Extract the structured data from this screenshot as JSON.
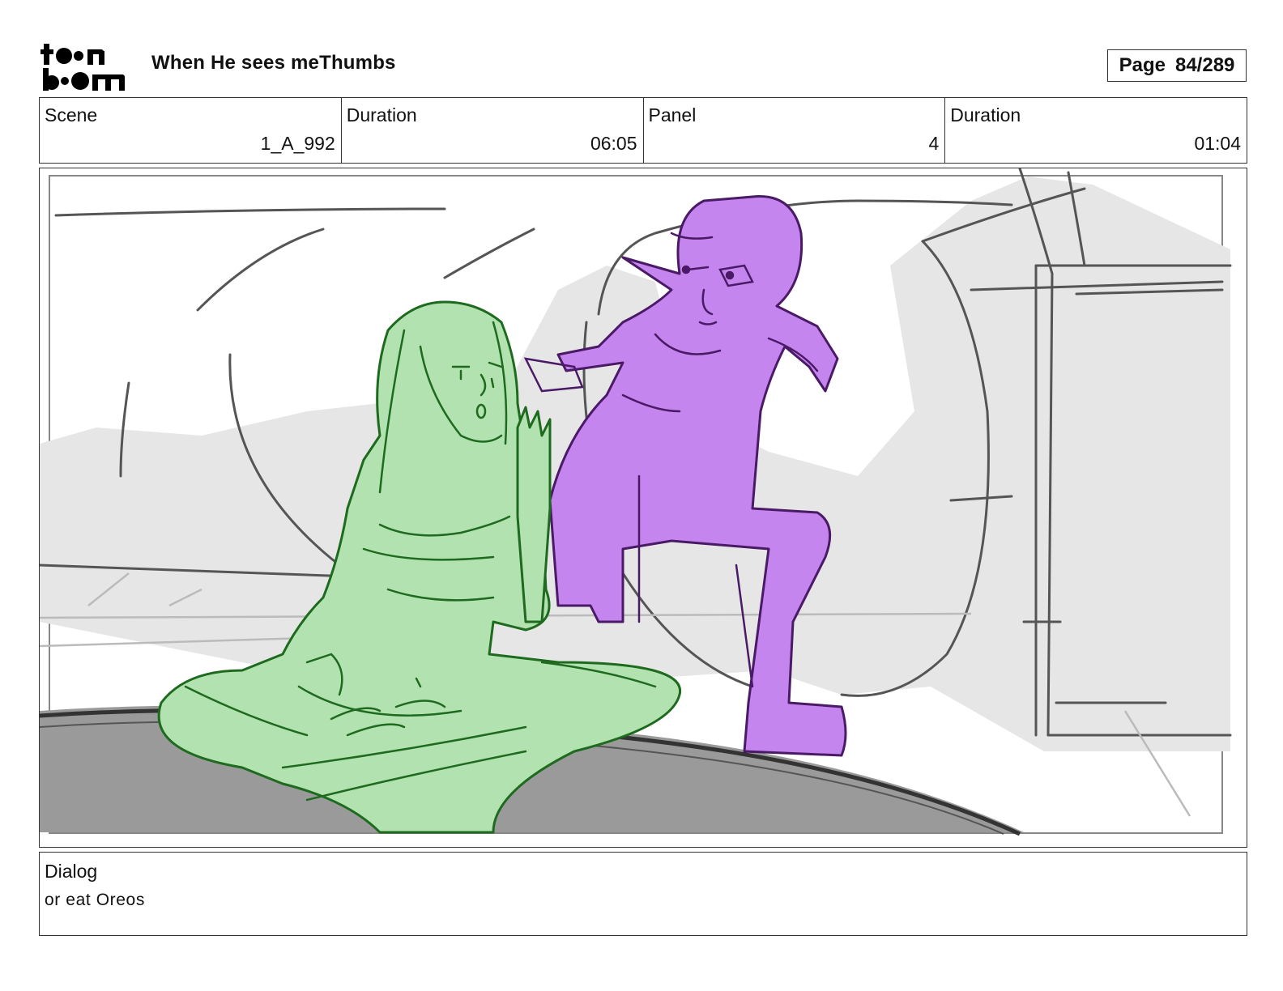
{
  "header": {
    "logo_text": "toon boom",
    "project_title": "When He sees meThumbs",
    "page_label": "Page",
    "page_number": "84/289"
  },
  "info": {
    "scene_label": "Scene",
    "scene_value": "1_A_992",
    "scene_duration_label": "Duration",
    "scene_duration_value": "06:05",
    "panel_label": "Panel",
    "panel_value": "4",
    "panel_duration_label": "Duration",
    "panel_duration_value": "01:04"
  },
  "dialog": {
    "label": "Dialog",
    "text": "or eat Oreos"
  },
  "colors": {
    "girl_fill": "#b2e2b0",
    "girl_line": "#1e6a1e",
    "boy_fill": "#c585ee",
    "boy_line": "#4a1a66",
    "floor_dark": "#9a9a9a",
    "shadow_gray": "#e6e6e6",
    "sketch_gray": "#555555"
  }
}
